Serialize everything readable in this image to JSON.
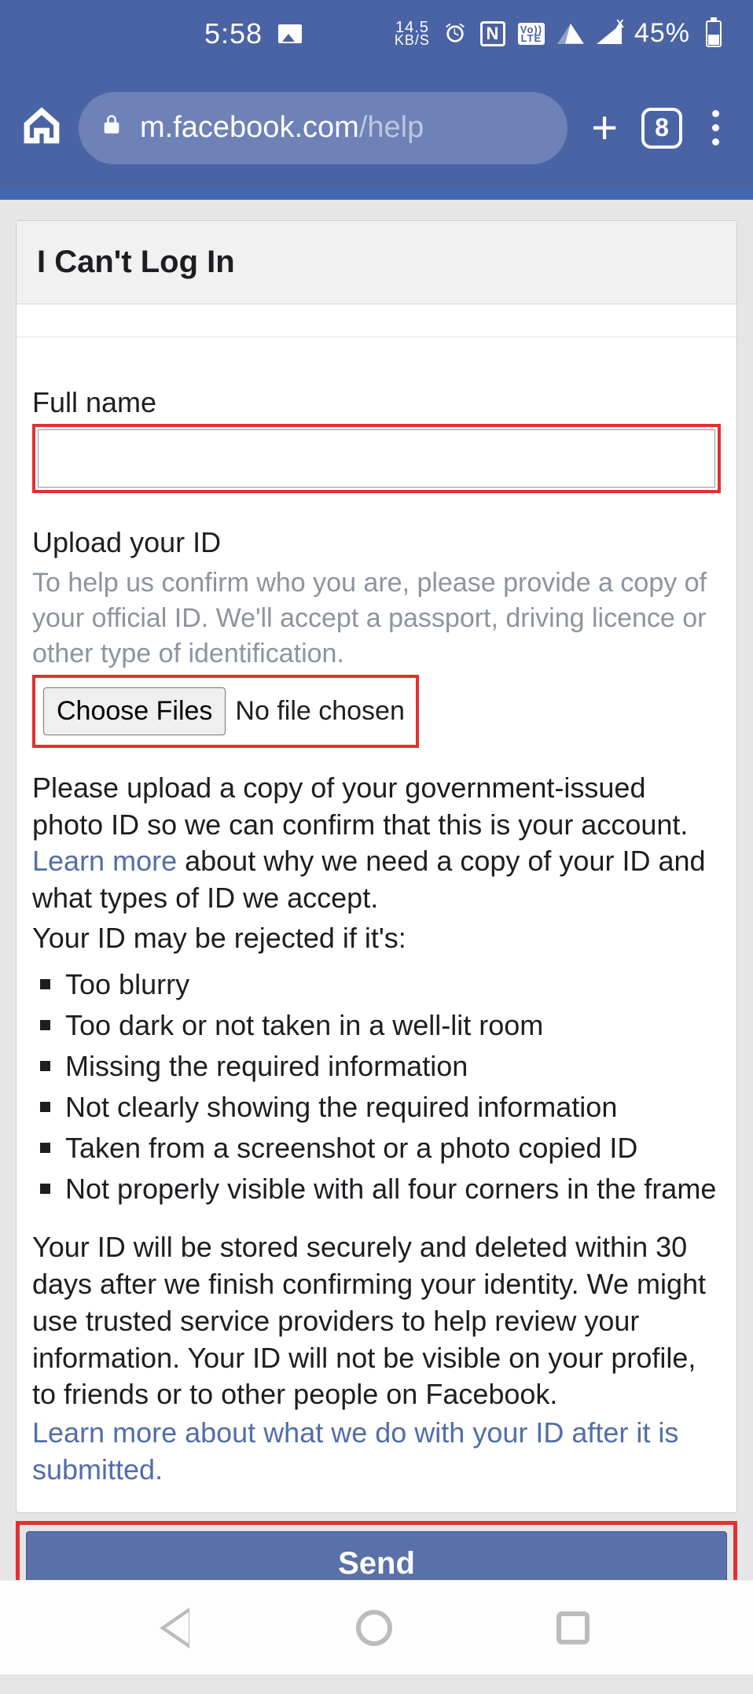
{
  "status_bar": {
    "time": "5:58",
    "net_speed_value": "14.5",
    "net_speed_unit": "KB/S",
    "nfc_label": "N",
    "lte_top": "Vo))",
    "lte_bottom": "LTE",
    "signal_x": "X",
    "battery_text": "45%"
  },
  "browser_bar": {
    "url_host": "m.facebook.com",
    "url_path": "/help",
    "tab_count": "8"
  },
  "page": {
    "title": "I Can't Log In",
    "full_name_label": "Full name",
    "full_name_value": "",
    "upload_label": "Upload your ID",
    "upload_help": "To help us confirm who you are, please provide a copy of your official ID. We'll accept a passport, driving licence or other type of identification.",
    "choose_files_btn": "Choose Files",
    "no_file_text": "No file chosen",
    "p1_a": "Please upload a copy of your government-issued photo ID so we can confirm that this is your account. ",
    "p1_link": "Learn more",
    "p1_b": " about why we need a copy of your ID and what types of ID we accept.",
    "p2": "Your ID may be rejected if it's:",
    "reject_reasons": [
      "Too blurry",
      "Too dark or not taken in a well-lit room",
      "Missing the required information",
      "Not clearly showing the required information",
      "Taken from a screenshot or a photo copied ID",
      "Not properly visible with all four corners in the frame"
    ],
    "p3": "Your ID will be stored securely and deleted within 30 days after we finish confirming your identity. We might use trusted service providers to help review your information. Your ID will not be visible on your profile, to friends or to other people on Facebook.",
    "p4_link": "Learn more about what we do with your ID after it is submitted.",
    "send_btn": "Send"
  }
}
